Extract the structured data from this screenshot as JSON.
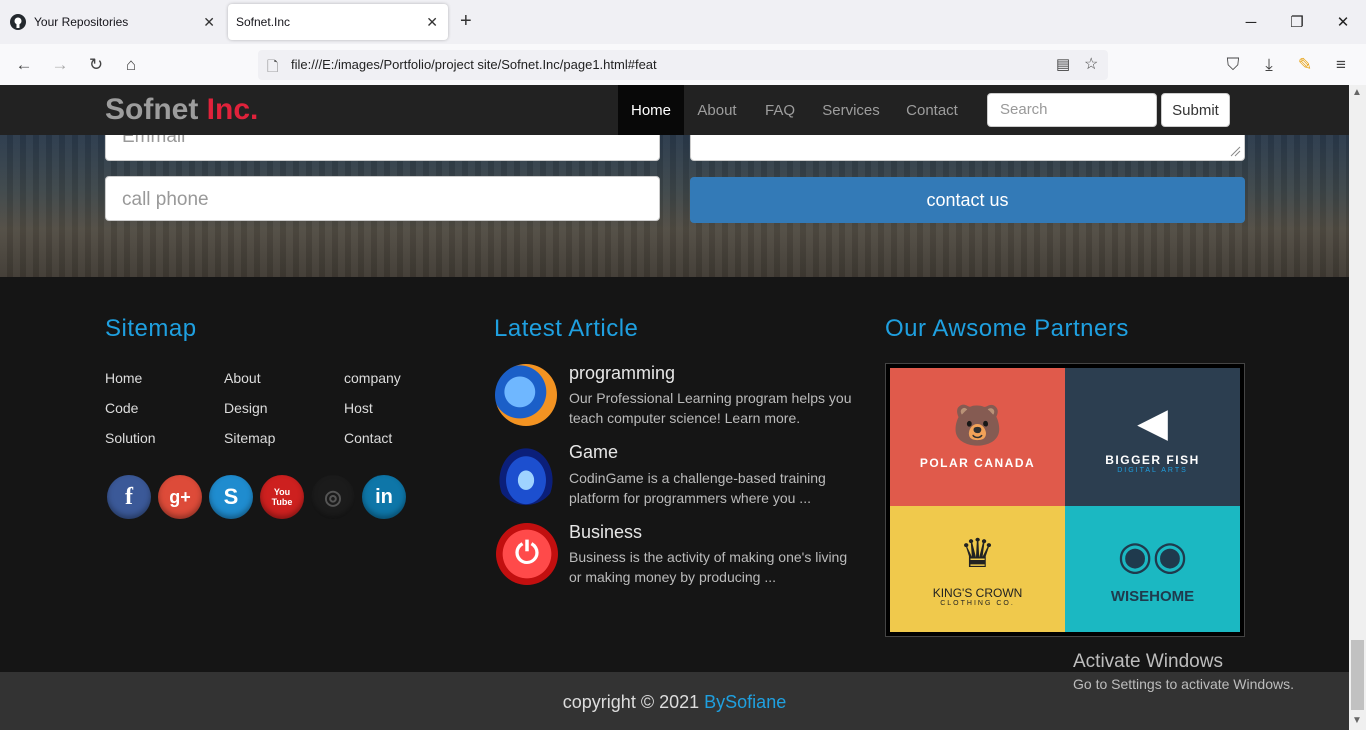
{
  "browser": {
    "tabs": [
      {
        "label": "Your Repositories",
        "icon": "github-icon"
      },
      {
        "label": "Sofnet.Inc",
        "icon": "page-icon"
      }
    ],
    "url": "file:///E:/images/Portfolio/project site/Sofnet.Inc/page1.html#feat"
  },
  "site": {
    "brand_main": "Sofnet",
    "brand_accent": "Inc.",
    "nav": [
      "Home",
      "About",
      "FAQ",
      "Services",
      "Contact"
    ],
    "search_placeholder": "Search",
    "submit_label": "Submit"
  },
  "contact_form": {
    "email_placeholder": "Emmail",
    "phone_placeholder": "call phone",
    "button_label": "contact us"
  },
  "footer": {
    "sitemap_title": "Sitemap",
    "sitemap_links": [
      "Home",
      "About",
      "company",
      "Code",
      "Design",
      "Host",
      "Solution",
      "Sitemap",
      "Contact"
    ],
    "social": [
      {
        "icon": "facebook-icon",
        "glyph": "f",
        "color": "#3b5998"
      },
      {
        "icon": "google-plus-icon",
        "glyph": "g+",
        "color": "#dd4b39"
      },
      {
        "icon": "skype-icon",
        "glyph": "S",
        "color": "#1f8ccf"
      },
      {
        "icon": "youtube-icon",
        "glyph": "You Tube",
        "color": "#cd201f"
      },
      {
        "icon": "instagram-icon",
        "glyph": "◎",
        "color": "#1b1b1b"
      },
      {
        "icon": "linkedin-icon",
        "glyph": "in",
        "color": "#0e76a8"
      }
    ],
    "articles_title": "Latest Article",
    "articles": [
      {
        "title": "programming",
        "text": "Our Professional Learning program helps you teach computer science! Learn more.",
        "icon": "firefox-icon"
      },
      {
        "title": "Game",
        "text": "CodinGame is a challenge-based training platform for programmers where you ...",
        "icon": "game-power-icon"
      },
      {
        "title": "Business",
        "text": "Business is the activity of making one's living or making money by producing ...",
        "icon": "power-button-icon"
      }
    ],
    "partners_title": "Our Awsome Partners",
    "partners": [
      {
        "name": "POLAR CANADA",
        "sub": "",
        "color": "#e05a4b"
      },
      {
        "name": "BIGGER FISH",
        "sub": "DIGITAL ARTS",
        "color": "#2c3e50"
      },
      {
        "name": "KING'S CROWN",
        "sub": "CLOTHING CO.",
        "color": "#f0c94c"
      },
      {
        "name": "WISEHOME",
        "sub": "",
        "color": "#1bb8c2"
      }
    ],
    "copyright_text": "copyright © 2021",
    "copyright_author": "BySofiane"
  },
  "windows_notice": {
    "title": "Activate Windows",
    "subtitle": "Go to Settings to activate Windows."
  }
}
